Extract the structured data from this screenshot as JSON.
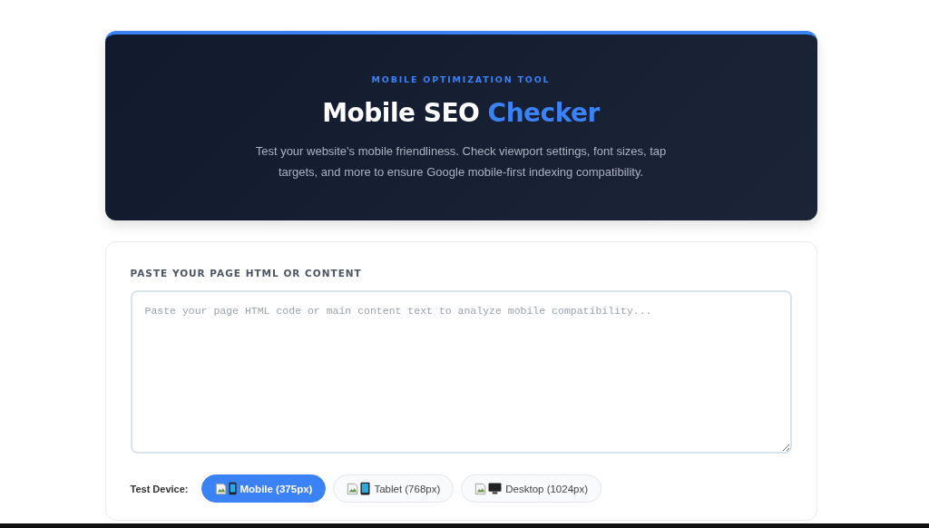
{
  "hero": {
    "eyebrow": "MOBILE OPTIMIZATION TOOL",
    "title": "Mobile SEO",
    "title_accent": "Checker",
    "description": "Test your website's mobile friendliness. Check viewport settings, font sizes, tap targets, and more to ensure Google mobile-first indexing compatibility."
  },
  "form": {
    "label": "PASTE YOUR PAGE HTML OR CONTENT",
    "placeholder": "Paste your page HTML code or main content text to analyze mobile compatibility...",
    "device_label": "Test Device:",
    "devices": [
      {
        "label": "Mobile (375px)",
        "kind": "phone",
        "selected": true
      },
      {
        "label": "Tablet (768px)",
        "kind": "tablet",
        "selected": false
      },
      {
        "label": "Desktop (1024px)",
        "kind": "desktop",
        "selected": false
      }
    ]
  }
}
